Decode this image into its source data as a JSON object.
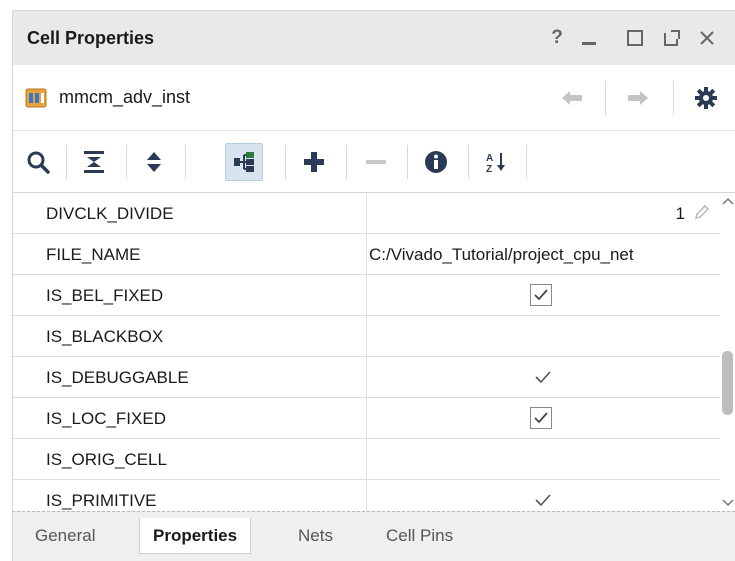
{
  "window": {
    "title": "Cell Properties",
    "controls": {
      "help": "?"
    }
  },
  "object": {
    "icon": "cell-instance-icon",
    "name": "mmcm_adv_inst"
  },
  "toolbar": {
    "buttons": [
      {
        "icon": "search-icon"
      },
      {
        "icon": "collapse-all-icon"
      },
      {
        "icon": "expand-collapse-icon"
      },
      {
        "icon": "group-by-category-icon",
        "active": true
      },
      {
        "icon": "add-icon"
      },
      {
        "icon": "remove-icon",
        "disabled": true
      },
      {
        "icon": "info-icon"
      },
      {
        "icon": "sort-az-icon"
      }
    ]
  },
  "properties": {
    "rows": [
      {
        "name": "DIVCLK_DIVIDE",
        "value": "1",
        "editable": true
      },
      {
        "name": "FILE_NAME",
        "value": "C:/Vivado_Tutorial/project_cpu_net"
      },
      {
        "name": "IS_BEL_FIXED",
        "value": "",
        "checkbox": true,
        "checked": true
      },
      {
        "name": "IS_BLACKBOX",
        "value": ""
      },
      {
        "name": "IS_DEBUGGABLE",
        "value": "",
        "readonly_check": true
      },
      {
        "name": "IS_LOC_FIXED",
        "value": "",
        "checkbox": true,
        "checked": true
      },
      {
        "name": "IS_ORIG_CELL",
        "value": ""
      },
      {
        "name": "IS_PRIMITIVE",
        "value": "",
        "readonly_check": true
      }
    ]
  },
  "tabs": [
    {
      "label": "General",
      "active": false
    },
    {
      "label": "Properties",
      "active": true
    },
    {
      "label": "Nets",
      "active": false
    },
    {
      "label": "Cell Pins",
      "active": false
    }
  ],
  "colors": {
    "accent_blue": "#1a5fa8",
    "icon_dark": "#2b3b55",
    "title_bg": "#e9e9e9",
    "tab_bg": "#efefef"
  }
}
